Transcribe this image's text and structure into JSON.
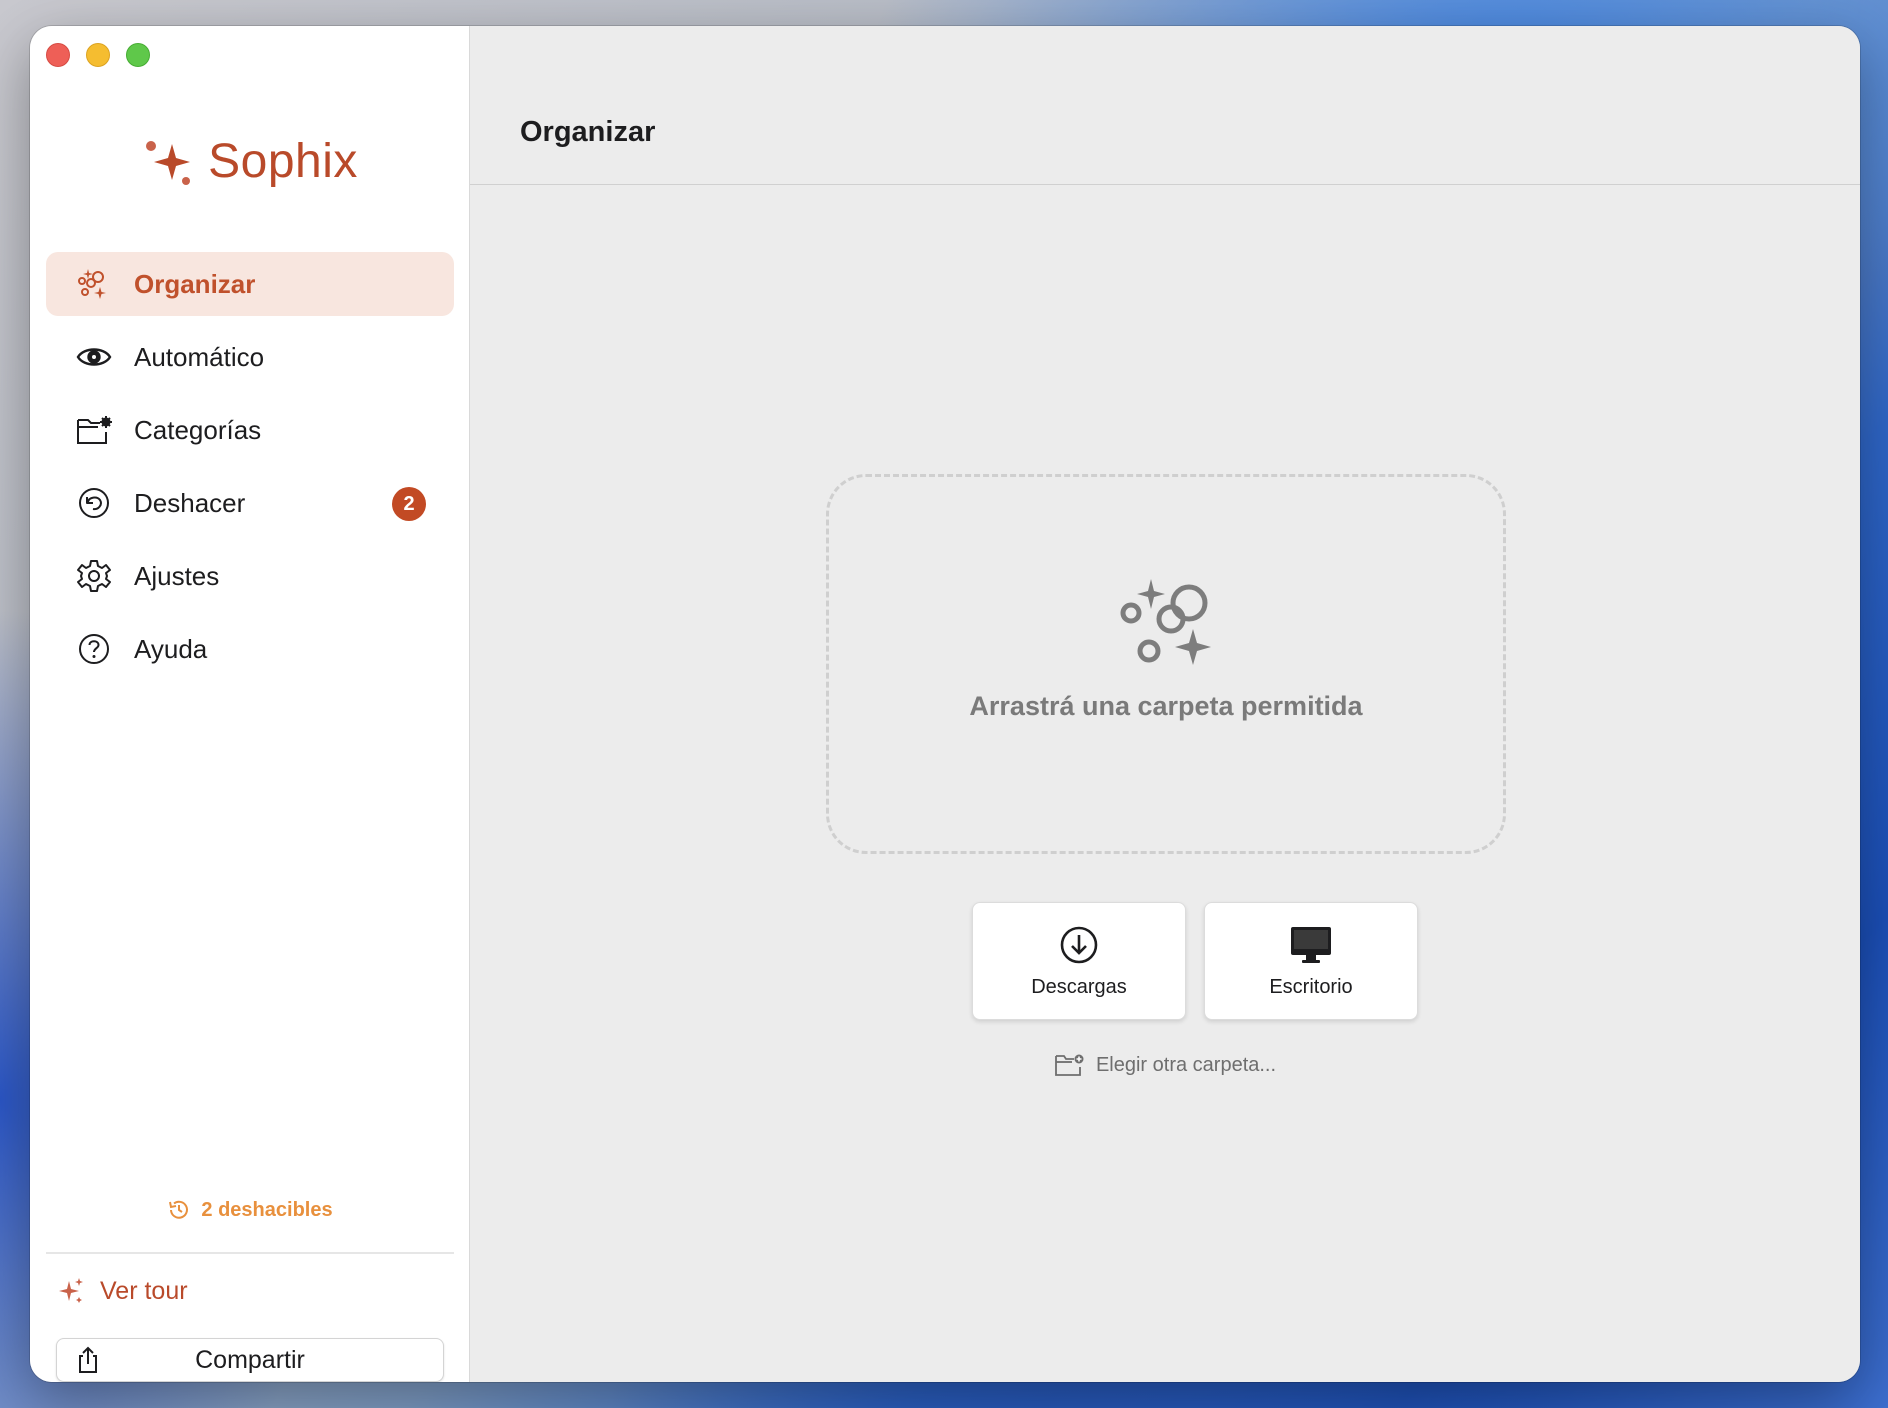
{
  "app": {
    "name": "Sophix"
  },
  "sidebar": {
    "items": [
      {
        "label": "Organizar",
        "icon": "sparkle-bubbles-icon",
        "active": true
      },
      {
        "label": "Automático",
        "icon": "eye-icon",
        "active": false
      },
      {
        "label": "Categorías",
        "icon": "folder-gear-icon",
        "active": false
      },
      {
        "label": "Deshacer",
        "icon": "undo-circle-icon",
        "active": false,
        "badge": "2"
      },
      {
        "label": "Ajustes",
        "icon": "gear-icon",
        "active": false
      },
      {
        "label": "Ayuda",
        "icon": "question-circle-icon",
        "active": false
      }
    ],
    "undo_count_label": "2 deshacibles",
    "tour_label": "Ver tour",
    "share_label": "Compartir"
  },
  "main": {
    "title": "Organizar",
    "dropzone": {
      "text": "Arrastrá una carpeta permitida"
    },
    "quick_folders": [
      {
        "label": "Descargas",
        "icon": "download-circle-icon"
      },
      {
        "label": "Escritorio",
        "icon": "desktop-monitor-icon"
      }
    ],
    "choose_other_label": "Elegir otra carpeta..."
  },
  "colors": {
    "accent": "#b94a2a",
    "active_bg": "#f8e6df",
    "badge": "#c24a24",
    "undo_orange": "#e8903d"
  }
}
